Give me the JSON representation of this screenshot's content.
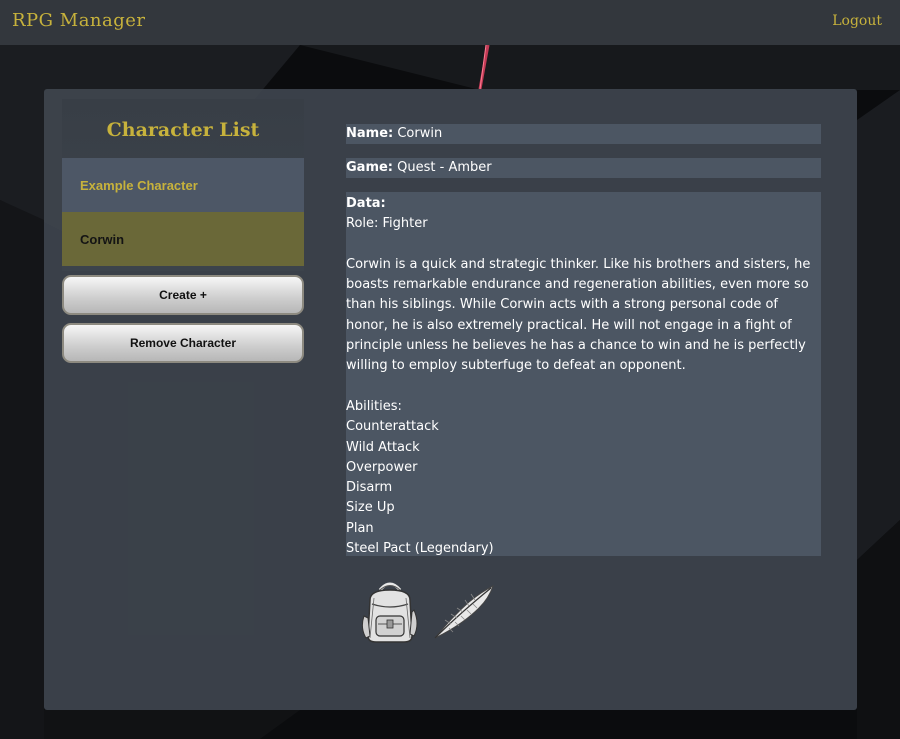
{
  "app": {
    "title": "RPG Manager",
    "logout_label": "Logout",
    "accent_color": "#c7b23c"
  },
  "sidebar": {
    "title": "Character List",
    "characters": [
      {
        "name": "Example Character",
        "selected": false
      },
      {
        "name": "Corwin",
        "selected": true
      }
    ],
    "create_label": "Create +",
    "remove_label": "Remove Character"
  },
  "details": {
    "name_label": "Name:",
    "name_value": "Corwin",
    "game_label": "Game:",
    "game_value": "Quest - Amber",
    "data_label": "Data:",
    "role_line": "Role: Fighter",
    "description": "Corwin is a quick and strategic thinker. Like his brothers and sisters, he boasts remarkable endurance and regeneration abilities, even more so than his siblings. While Corwin acts with a strong personal code of honor, he is also extremely practical. He will not engage in a fight of principle unless he believes he has a chance to win and he is perfectly willing to employ subterfuge to defeat an opponent.",
    "abilities_header": "Abilities:",
    "abilities": [
      "Counterattack",
      "Wild Attack",
      "Overpower",
      "Disarm",
      "Size Up",
      "Plan",
      "Steel Pact (Legendary)"
    ]
  },
  "icons": {
    "inventory": "backpack-icon",
    "edit": "quill-icon"
  }
}
